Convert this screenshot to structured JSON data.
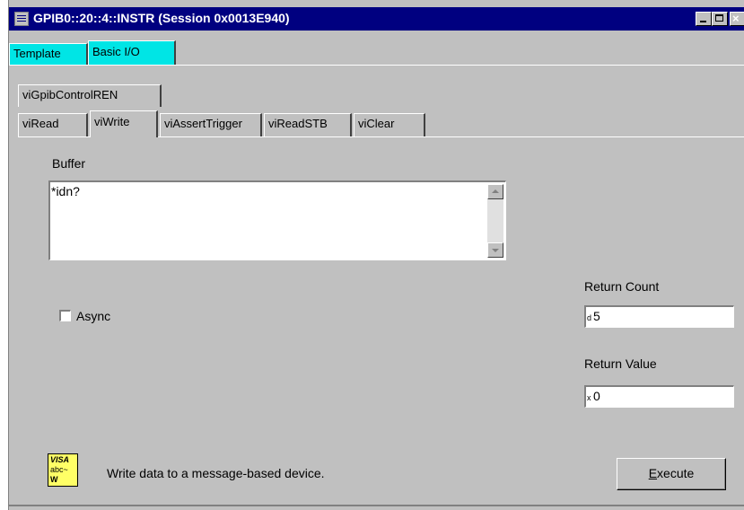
{
  "window": {
    "title": "GPIB0::20::4::INSTR (Session 0x0013E940)",
    "controls": {
      "minimize": "_",
      "maximize": "□",
      "close": "×"
    }
  },
  "top_tabs": [
    {
      "label": "Template",
      "selected": false
    },
    {
      "label": "Basic I/O",
      "selected": true
    }
  ],
  "operation_tabs": {
    "row1": [
      {
        "label": "viGpibControlREN"
      }
    ],
    "row2": [
      {
        "label": "viRead"
      },
      {
        "label": "viWrite",
        "selected": true
      },
      {
        "label": "viAssertTrigger"
      },
      {
        "label": "viReadSTB"
      },
      {
        "label": "viClear"
      }
    ]
  },
  "buffer": {
    "label": "Buffer",
    "value": "*idn?"
  },
  "async": {
    "label": "Async",
    "checked": false
  },
  "return_count": {
    "label": "Return Count",
    "radix": "d",
    "value": "5"
  },
  "return_value": {
    "label": "Return Value",
    "radix": "x",
    "value": "0"
  },
  "footer": {
    "description": "Write data to a message-based device.",
    "icon_lines": [
      "VISA",
      "abc~",
      "W"
    ],
    "execute_prefix": "E",
    "execute_rest": "xecute"
  },
  "colors": {
    "titlebar": "#000080",
    "tab_highlight": "#00e5e5",
    "dialog": "#c0c0c0"
  }
}
